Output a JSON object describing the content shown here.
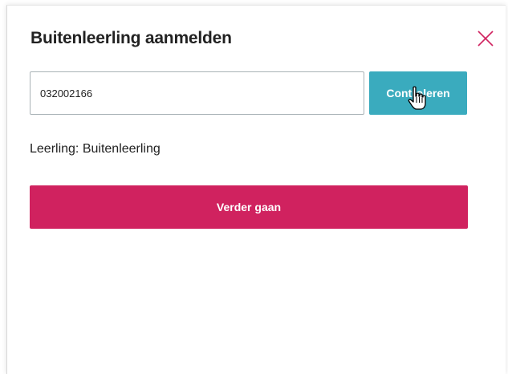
{
  "dialog": {
    "title": "Buitenleerling aanmelden",
    "close_icon": "close-icon",
    "id_input": {
      "value": "032002166",
      "placeholder": ""
    },
    "check_button_label": "Controleren",
    "student_line": "Leerling: Buitenleerling",
    "continue_button_label": "Verder gaan"
  },
  "colors": {
    "accent_teal": "#3aabbe",
    "accent_pink": "#d0225f",
    "text": "#222222"
  }
}
